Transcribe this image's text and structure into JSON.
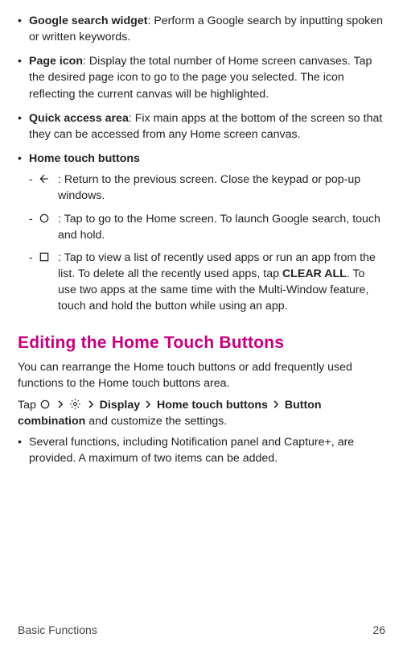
{
  "items": {
    "google_widget": {
      "label": "Google search widget",
      "text": ": Perform a Google search by inputting spoken or written keywords."
    },
    "page_icon": {
      "label": "Page icon",
      "text": ": Display the total number of Home screen canvases. Tap the desired page icon to go to the page you selected. The icon reflecting the current canvas will be highlighted."
    },
    "quick_access": {
      "label": "Quick access area",
      "text": ": Fix main apps at the bottom of the screen so that they can be accessed from any Home screen canvas."
    },
    "home_touch": {
      "label": "Home touch buttons",
      "back": " : Return to the previous screen. Close the keypad or pop-up windows.",
      "home": " : Tap to go to the Home screen. To launch Google search, touch and hold.",
      "recent_a": " : Tap to view a list of recently used apps or run an app from the list. To delete all the recently used apps, tap ",
      "recent_clear": "CLEAR ALL",
      "recent_b": ". To use two apps at the same time with the Multi-Window feature, touch and hold the button while using an app."
    }
  },
  "section": {
    "heading": "Editing the Home Touch Buttons",
    "intro": "You can rearrange the Home touch buttons or add frequently used functions to the Home touch buttons area.",
    "path_tap": "Tap ",
    "path_display": "Display",
    "path_htb": "Home touch buttons",
    "path_combo": "Button combination",
    "path_tail": " and customize the settings.",
    "bullet": "Several functions, including Notification panel and Capture+, are provided. A maximum of two items can be added."
  },
  "footer": {
    "section": "Basic Functions",
    "page": "26"
  }
}
